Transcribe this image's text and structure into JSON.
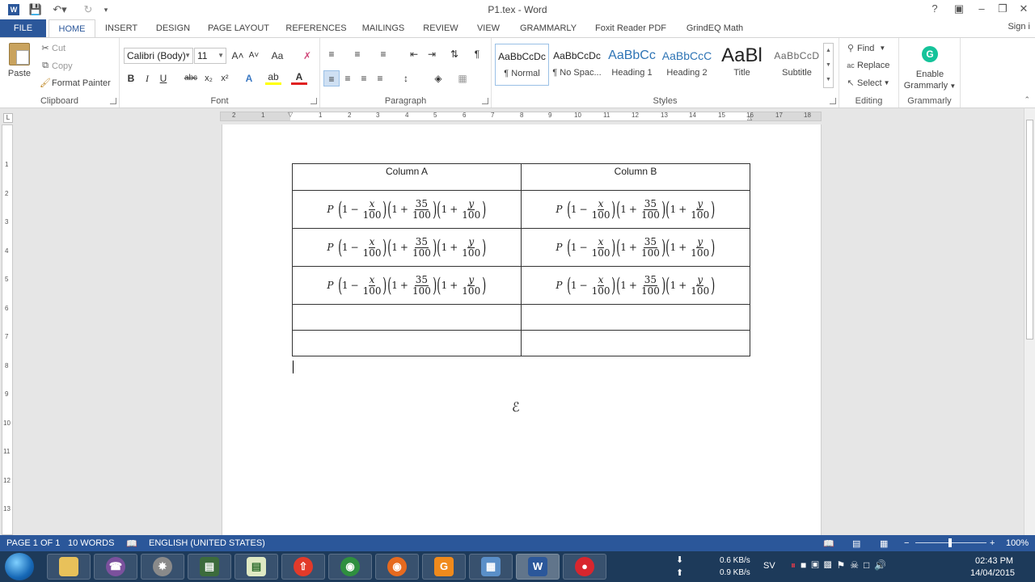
{
  "window": {
    "title": "P1.tex - Word",
    "help": "?",
    "minimize": "–",
    "restore": "❐",
    "close": "✕"
  },
  "tabs": {
    "file": "FILE",
    "items": [
      "HOME",
      "INSERT",
      "DESIGN",
      "PAGE LAYOUT",
      "REFERENCES",
      "MAILINGS",
      "REVIEW",
      "VIEW",
      "GRAMMARLY",
      "Foxit Reader PDF",
      "GrindEQ Math"
    ],
    "sign_in": "Sign i"
  },
  "clipboard": {
    "paste": "Paste",
    "cut": "Cut",
    "copy": "Copy",
    "format_painter": "Format Painter",
    "label": "Clipboard"
  },
  "font": {
    "name": "Calibri (Body)",
    "size": "11",
    "bold": "B",
    "italic": "I",
    "underline": "U",
    "strike": "abc",
    "subscript": "x₂",
    "superscript": "x²",
    "grow": "A˄",
    "shrink": "A˅",
    "change_case": "Aa",
    "text_effects": "A",
    "highlight": "ab",
    "font_color": "A",
    "label": "Font"
  },
  "paragraph": {
    "label": "Paragraph",
    "pilcrow": "¶"
  },
  "styles": {
    "label": "Styles",
    "items": [
      {
        "sample": "AaBbCcDc",
        "name": "¶ Normal"
      },
      {
        "sample": "AaBbCcDc",
        "name": "¶ No Spac..."
      },
      {
        "sample": "AaBbCc",
        "name": "Heading 1"
      },
      {
        "sample": "AaBbCcC",
        "name": "Heading 2"
      },
      {
        "sample": "AaBl",
        "name": "Title"
      },
      {
        "sample": "AaBbCcD",
        "name": "Subtitle"
      }
    ]
  },
  "editing": {
    "find": "Find",
    "replace": "Replace",
    "select": "Select",
    "label": "Editing"
  },
  "grammarly": {
    "enable": "Enable",
    "grammarly": "Grammarly",
    "label": "Grammarly"
  },
  "ruler": {
    "h_numbers": [
      "2",
      "1",
      "1",
      "2",
      "3",
      "4",
      "5",
      "6",
      "7",
      "8",
      "9",
      "10",
      "11",
      "12",
      "13",
      "14",
      "15",
      "16",
      "17",
      "18"
    ],
    "v_numbers": [
      "1",
      "2",
      "3",
      "4",
      "5",
      "6",
      "7",
      "8",
      "9",
      "10",
      "11",
      "12",
      "13"
    ]
  },
  "document": {
    "table": {
      "headers": [
        "Column A",
        "Column B"
      ],
      "equation": {
        "P": "P",
        "one": "1",
        "minus": "−",
        "plus": "+",
        "x": "x",
        "y": "y",
        "n35": "35",
        "d100": "100",
        "lparen": "(",
        "rparen": ")"
      }
    }
  },
  "status": {
    "page": "PAGE 1 OF 1",
    "words": "10 WORDS",
    "language": "ENGLISH (UNITED STATES)",
    "zoom": "100%",
    "zoom_minus": "−",
    "zoom_plus": "+"
  },
  "taskbar": {
    "net_down": "0.6 KB/s",
    "net_up": "0.9 KB/s",
    "lang": "SV",
    "time": "02:43 PM",
    "date": "14/04/2015"
  }
}
